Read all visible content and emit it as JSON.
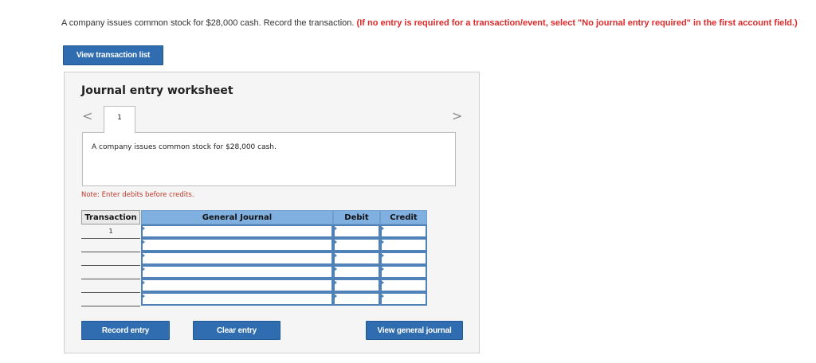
{
  "question": {
    "text": "A company issues common stock for $28,000 cash. Record the transaction. ",
    "warning": "(If no entry is required for a transaction/event, select \"No journal entry required\" in the first account field.)"
  },
  "view_list_label": "View transaction list",
  "worksheet": {
    "title": "Journal entry worksheet",
    "prev_glyph": "<",
    "next_glyph": ">",
    "active_tab": "1",
    "description": "A company issues common stock for $28,000 cash.",
    "note": "Note: Enter debits before credits.",
    "table": {
      "headers": [
        "Transaction",
        "General Journal",
        "Debit",
        "Credit"
      ],
      "rows": [
        {
          "transaction": "1",
          "account": "",
          "debit": "",
          "credit": ""
        },
        {
          "transaction": "",
          "account": "",
          "debit": "",
          "credit": ""
        },
        {
          "transaction": "",
          "account": "",
          "debit": "",
          "credit": ""
        },
        {
          "transaction": "",
          "account": "",
          "debit": "",
          "credit": ""
        },
        {
          "transaction": "",
          "account": "",
          "debit": "",
          "credit": ""
        },
        {
          "transaction": "",
          "account": "",
          "debit": "",
          "credit": ""
        }
      ]
    },
    "buttons": {
      "record": "Record entry",
      "clear": "Clear entry",
      "view_general_journal": "View general journal"
    }
  },
  "colors": {
    "button_blue": "#2f6db0",
    "header_blue": "#7fb0e0",
    "input_border": "#4e82b8",
    "warning_red": "#e02a2a"
  }
}
